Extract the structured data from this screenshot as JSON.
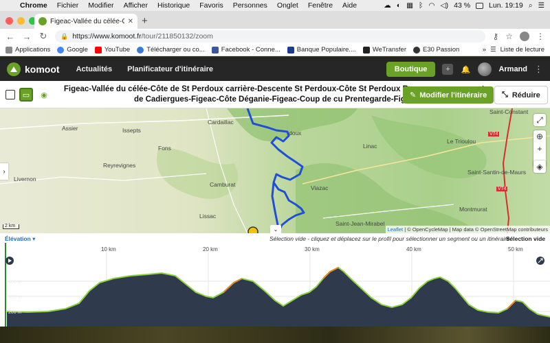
{
  "menubar": {
    "app": "Chrome",
    "items": [
      "Fichier",
      "Modifier",
      "Afficher",
      "Historique",
      "Favoris",
      "Personnes",
      "Onglet",
      "Fenêtre",
      "Aide"
    ],
    "battery": "43 %",
    "clock": "Lun. 19:19"
  },
  "browser": {
    "tab_title": "Figeac-Vallée du célée-Côte de S",
    "url_host": "https://www.komoot.fr",
    "url_path": "/tour/211850132/zoom",
    "bookmarks": [
      {
        "label": "Applications",
        "color": "#888888"
      },
      {
        "label": "Google",
        "color": "#4285f4"
      },
      {
        "label": "YouTube",
        "color": "#ff0000"
      },
      {
        "label": "Télécharger ou co...",
        "color": "#3a7bd5"
      },
      {
        "label": "Facebook - Conne...",
        "color": "#3b5998"
      },
      {
        "label": "Banque Populaire....",
        "color": "#1a3d8f"
      },
      {
        "label": "WeTransfer",
        "color": "#222222"
      },
      {
        "label": "E30 Passion",
        "color": "#333333"
      }
    ],
    "reading_list": "Liste de lecture"
  },
  "komoot": {
    "logo": "komoot",
    "nav": [
      "Actualités",
      "Planificateur d'itinéraire"
    ],
    "shop_button": "Boutique",
    "user": "Armand",
    "brand_color": "#6aa127"
  },
  "tour": {
    "title_line1": "Figeac-Vallée du célée-Côte de St Perdoux carrière-Descente St Perdoux-Côte St Perdoux Bo",
    "title_line1_tail": "te",
    "title_line2": "de Cadiergues-Figeac-Côte Déganie-Figeac-Coup de cu Prentegarde-Figeac",
    "modify_button": "Modifier l'itinéraire",
    "reduce_button": "Réduire"
  },
  "map": {
    "places": [
      "Assier",
      "Cardaillac",
      "Issepts",
      "Fons",
      "Reyrevignes",
      "Livernon",
      "Camburat",
      "Lissac",
      "Viazac",
      "Linac",
      "Le Trioulou",
      "Saint-Constant",
      "Saint-Santin-de-Maurs",
      "Montmurat",
      "Saint-Jean-Mirabel",
      "doux"
    ],
    "road_labels": [
      "V74",
      "V74"
    ],
    "scale": "2 km",
    "attribution_leaflet": "Leaflet",
    "attribution_rest": " | © OpenCycleMap | Map data © OpenStreetMap contributeurs"
  },
  "elevation": {
    "label": "Élévation",
    "hint": "Sélection vide - cliquez et déplacez sur le profil pour sélectionner un segment ou un itinéraire.",
    "selection": "Sélection vide",
    "distance_ticks": [
      "10 km",
      "20 km",
      "30 km",
      "40 km",
      "50 km"
    ],
    "altitude_ticks": [
      "400 m",
      "300 m",
      "200 m"
    ]
  }
}
